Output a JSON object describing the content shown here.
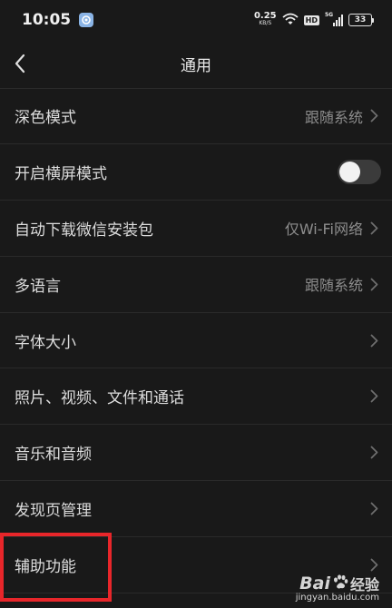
{
  "status_bar": {
    "time": "10:05",
    "net_speed_value": "0.25",
    "net_speed_unit": "KB/S",
    "hd_badge": "HD",
    "signal_label": "5G",
    "battery": "33"
  },
  "nav": {
    "title": "通用",
    "back_icon": "chevron-left-icon"
  },
  "settings": [
    {
      "label": "深色模式",
      "value": "跟随系统",
      "type": "link"
    },
    {
      "label": "开启横屏模式",
      "value": "",
      "type": "toggle",
      "toggle_on": false
    },
    {
      "label": "自动下载微信安装包",
      "value": "仅Wi-Fi网络",
      "type": "link"
    },
    {
      "label": "多语言",
      "value": "跟随系统",
      "type": "link"
    },
    {
      "label": "字体大小",
      "value": "",
      "type": "link"
    },
    {
      "label": "照片、视频、文件和通话",
      "value": "",
      "type": "link"
    },
    {
      "label": "音乐和音频",
      "value": "",
      "type": "link"
    },
    {
      "label": "发现页管理",
      "value": "",
      "type": "link"
    },
    {
      "label": "辅助功能",
      "value": "",
      "type": "link"
    }
  ],
  "watermark": {
    "logo": "Bai",
    "text": "经验",
    "url": "jingyan.baidu.com"
  },
  "colors": {
    "background": "#191919",
    "text": "#dcdcdc",
    "secondary_text": "#8d8d8d",
    "highlight": "#e8262a"
  }
}
